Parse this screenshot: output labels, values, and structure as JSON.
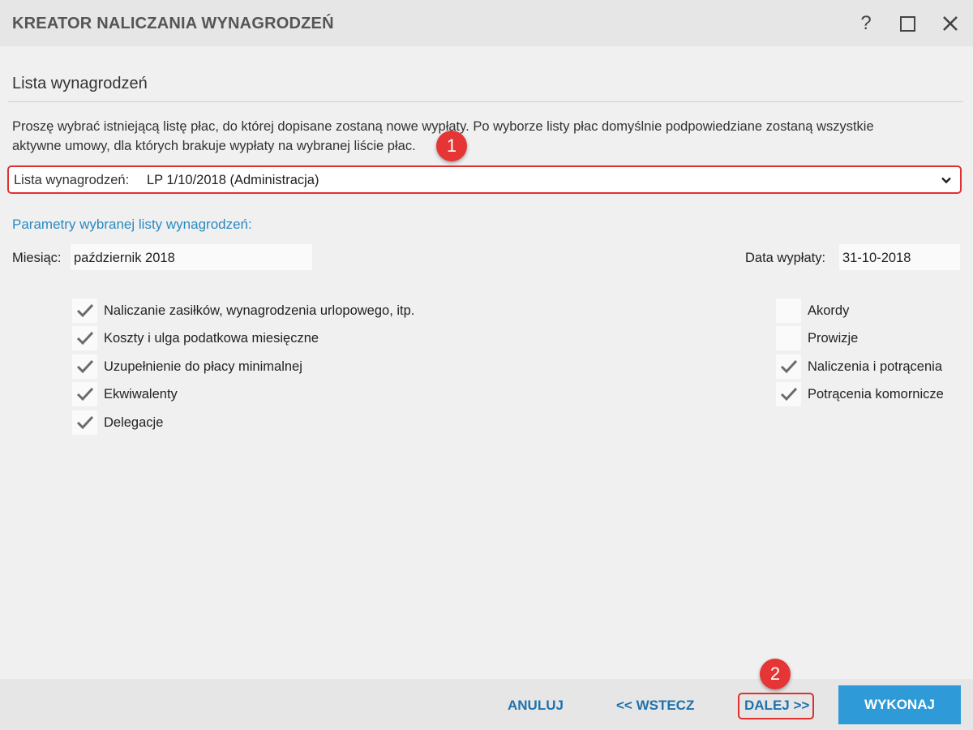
{
  "window": {
    "title": "KREATOR NALICZANIA WYNAGRODZEŃ",
    "help_label": "?"
  },
  "section": {
    "title": "Lista wynagrodzeń",
    "description_line1": "Proszę wybrać istniejącą listę płac, do której dopisane zostaną nowe wypłaty. Po wyborze listy płac domyślnie podpowiedziane zostaną wszystkie",
    "description_line2": "aktywne umowy, dla których brakuje wypłaty na wybranej liście płac."
  },
  "payroll_select": {
    "label": "Lista wynagrodzeń:",
    "value": "LP 1/10/2018 (Administracja)"
  },
  "params": {
    "title": "Parametry wybranej listy wynagrodzeń:",
    "month_label": "Miesiąc:",
    "month_value": "październik 2018",
    "payday_label": "Data wypłaty:",
    "payday_value": "31-10-2018"
  },
  "options_left": [
    {
      "label": "Naliczanie zasiłków, wynagrodzenia urlopowego, itp.",
      "checked": true
    },
    {
      "label": "Koszty i ulga podatkowa miesięczne",
      "checked": true
    },
    {
      "label": "Uzupełnienie do płacy minimalnej",
      "checked": true
    },
    {
      "label": "Ekwiwalenty",
      "checked": true
    },
    {
      "label": "Delegacje",
      "checked": true
    }
  ],
  "options_right": [
    {
      "label": "Akordy",
      "checked": false
    },
    {
      "label": "Prowizje",
      "checked": false
    },
    {
      "label": "Naliczenia i potrącenia",
      "checked": true
    },
    {
      "label": "Potrącenia komornicze",
      "checked": true
    }
  ],
  "footer": {
    "cancel_label": "ANULUJ",
    "back_label": "<< WSTECZ",
    "next_label": "DALEJ >>",
    "execute_label": "WYKONAJ"
  },
  "markers": {
    "marker1": "1",
    "marker2": "2"
  },
  "colors": {
    "accent": "#2e9ad8",
    "link": "#1f72ad",
    "highlight": "#e03030",
    "check": "#6b6b6b"
  }
}
